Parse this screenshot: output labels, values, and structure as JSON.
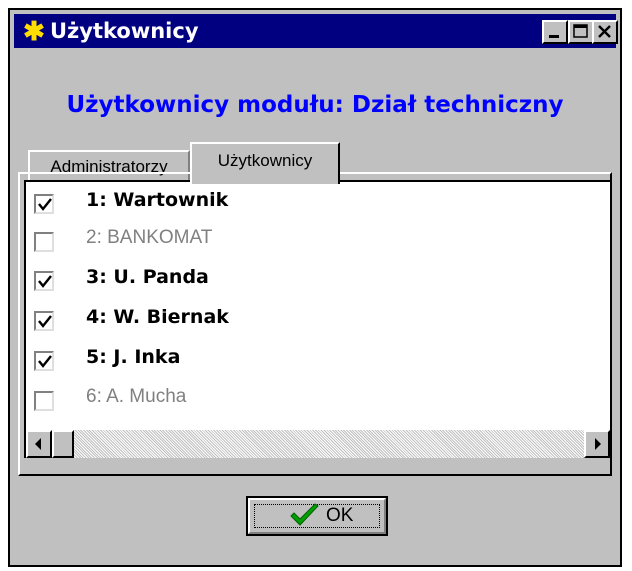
{
  "window": {
    "title": "Użytkownicy",
    "title_icon": "asterisk-icon",
    "controls": [
      "minimize-icon",
      "maximize-icon",
      "close-icon"
    ]
  },
  "header": {
    "title": "Użytkownicy modułu: Dział techniczny"
  },
  "tabs": [
    {
      "label": "Administratorzy",
      "active": false
    },
    {
      "label": "Użytkownicy",
      "active": true
    }
  ],
  "users": [
    {
      "label": "1: Wartownik",
      "checked": true
    },
    {
      "label": "2: BANKOMAT",
      "checked": false
    },
    {
      "label": "3: U. Panda",
      "checked": true
    },
    {
      "label": "4: W. Biernak",
      "checked": true
    },
    {
      "label": "5: J. Inka",
      "checked": true
    },
    {
      "label": "6: A. Mucha",
      "checked": false
    }
  ],
  "ok_button": {
    "label": "OK",
    "icon": "checkmark-icon"
  },
  "colors": {
    "titlebar": "#000080",
    "header_text": "#0000ff",
    "checkmark_green": "#00a000",
    "face": "#c0c0c0"
  }
}
